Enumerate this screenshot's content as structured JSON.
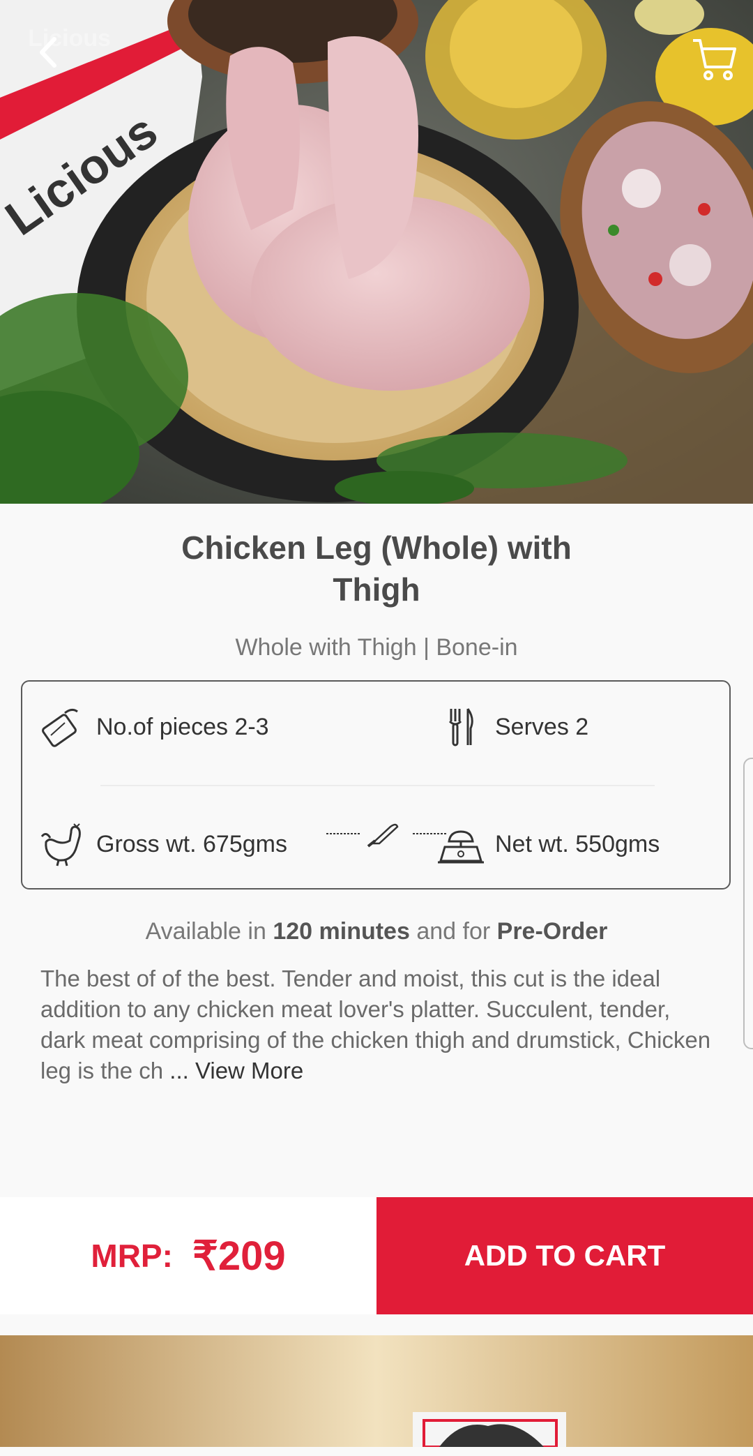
{
  "hero": {
    "watermark": "Licious",
    "box_brand": "Licious"
  },
  "product": {
    "title_line1": "Chicken Leg (Whole) with",
    "title_line2": "Thigh",
    "subtitle": "Whole with Thigh | Bone-in"
  },
  "specs": {
    "pieces": "No.of pieces 2-3",
    "serves": "Serves 2",
    "gross": "Gross wt. 675gms",
    "net": "Net wt. 550gms"
  },
  "availability": {
    "prefix": "Available in",
    "time": "120 minutes",
    "middle": "and for",
    "mode": "Pre-Order"
  },
  "description": {
    "text": "The best of of the best. Tender and moist, this cut is the ideal addition to any chicken meat lover's platter. Succulent, tender, dark meat comprising of the chicken thigh and drumstick, Chicken leg is the ch",
    "more": "... View More"
  },
  "purchase": {
    "mrp_label": "MRP:",
    "price": "₹209",
    "add_label": "ADD TO CART"
  },
  "colors": {
    "accent": "#e11c37",
    "text": "#4a4a4a"
  },
  "icons": [
    "back-icon",
    "cart-icon",
    "pieces-icon",
    "cutlery-icon",
    "rooster-icon",
    "knife-icon",
    "scale-icon"
  ]
}
